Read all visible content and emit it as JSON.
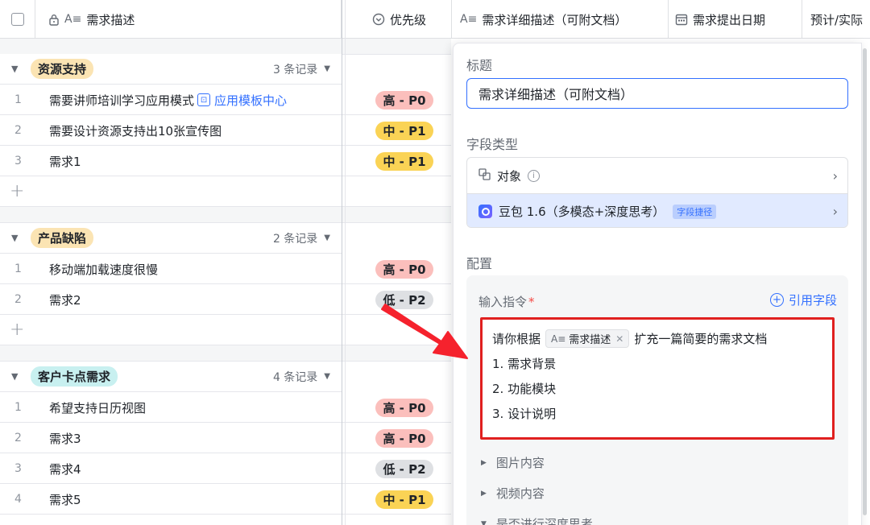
{
  "header": {
    "desc_col": "需求描述",
    "priority_col": "优先级",
    "detail_col": "需求详细描述（可附文档）",
    "date_col": "需求提出日期",
    "est_col": "预计/实际"
  },
  "groups": [
    {
      "tag": "资源支持",
      "count": "3 条记录",
      "rows": [
        {
          "num": "1",
          "desc": "需要讲师培训学习应用模式",
          "link": "应用模板中心",
          "priority": "高 - P0"
        },
        {
          "num": "2",
          "desc": "需要设计资源支持出10张宣传图",
          "priority": "中 - P1"
        },
        {
          "num": "3",
          "desc": "需求1",
          "priority": "中 - P1"
        }
      ]
    },
    {
      "tag": "产品缺陷",
      "count": "2 条记录",
      "rows": [
        {
          "num": "1",
          "desc": "移动端加载速度很慢",
          "priority": "高 - P0"
        },
        {
          "num": "2",
          "desc": "需求2",
          "priority": "低 - P2"
        }
      ]
    },
    {
      "tag": "客户卡点需求",
      "count": "4 条记录",
      "rows": [
        {
          "num": "1",
          "desc": "希望支持日历视图",
          "priority": "高 - P0"
        },
        {
          "num": "2",
          "desc": "需求3",
          "priority": "高 - P0"
        },
        {
          "num": "3",
          "desc": "需求4",
          "priority": "低 - P2"
        },
        {
          "num": "4",
          "desc": "需求5",
          "priority": "中 - P1"
        }
      ]
    }
  ],
  "panel": {
    "title_label": "标题",
    "title_value": "需求详细描述（可附文档）",
    "type_label": "字段类型",
    "type_object": "对象",
    "type_ai": "豆包 1.6（多模态+深度思考）",
    "type_ai_tag": "字段捷径",
    "config_label": "配置",
    "cmd_label": "输入指令",
    "cmd_required": "*",
    "ref_field": "引用字段",
    "prompt_prefix": "请你根据",
    "prompt_chip": "需求描述",
    "prompt_suffix": "扩充一篇简要的需求文档",
    "prompt_line2": "1. 需求背景",
    "prompt_line3": "2. 功能模块",
    "prompt_line4": "3. 设计说明",
    "image_content": "图片内容",
    "video_content": "视频内容",
    "deep_think": "是否进行深度思考"
  },
  "colors": {
    "group1": "#fbe4b3",
    "group2": "#fbe4b3",
    "group3": "#c8f0f0",
    "accent": "#3370ff",
    "highlight_box": "#e0201f"
  }
}
